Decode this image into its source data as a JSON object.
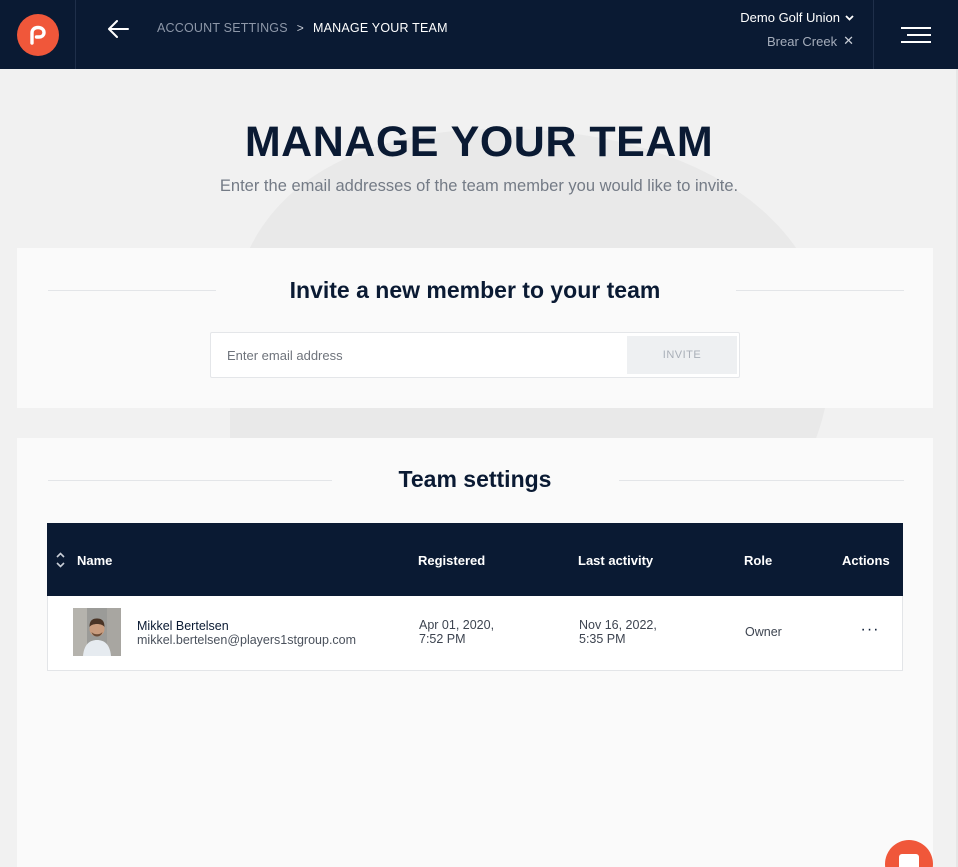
{
  "header": {
    "logo_icon": "brand-logo-icon",
    "back_icon": "arrow-left-icon",
    "breadcrumb": [
      "ACCOUNT SETTINGS",
      "MANAGE YOUR TEAM"
    ],
    "breadcrumb_separator": ">",
    "organization": "Demo Golf Union",
    "club": "Brear Creek",
    "club_clear": "✕",
    "menu_icon": "hamburger-menu-icon"
  },
  "hero": {
    "title": "MANAGE YOUR TEAM",
    "subtitle": "Enter the email addresses of the team member you would like to invite."
  },
  "invite": {
    "heading": "Invite a new member to your team",
    "placeholder": "Enter email address",
    "button_label": "INVITE"
  },
  "team": {
    "heading": "Team settings",
    "columns": [
      "Name",
      "Registered",
      "Last activity",
      "Role",
      "Actions"
    ],
    "rows": [
      {
        "name": "Mikkel Bertelsen",
        "email": "mikkel.bertelsen@players1stgroup.com",
        "registered_date": "Apr 01, 2020,",
        "registered_time": "7:52 PM",
        "last_activity_date": "Nov 16, 2022,",
        "last_activity_time": "5:35 PM",
        "role": "Owner",
        "actions": "···"
      }
    ]
  },
  "colors": {
    "navy": "#0a1a33",
    "accent": "#f0573a",
    "page_bg": "#f1f1f1",
    "card_bg": "#fafafa"
  }
}
